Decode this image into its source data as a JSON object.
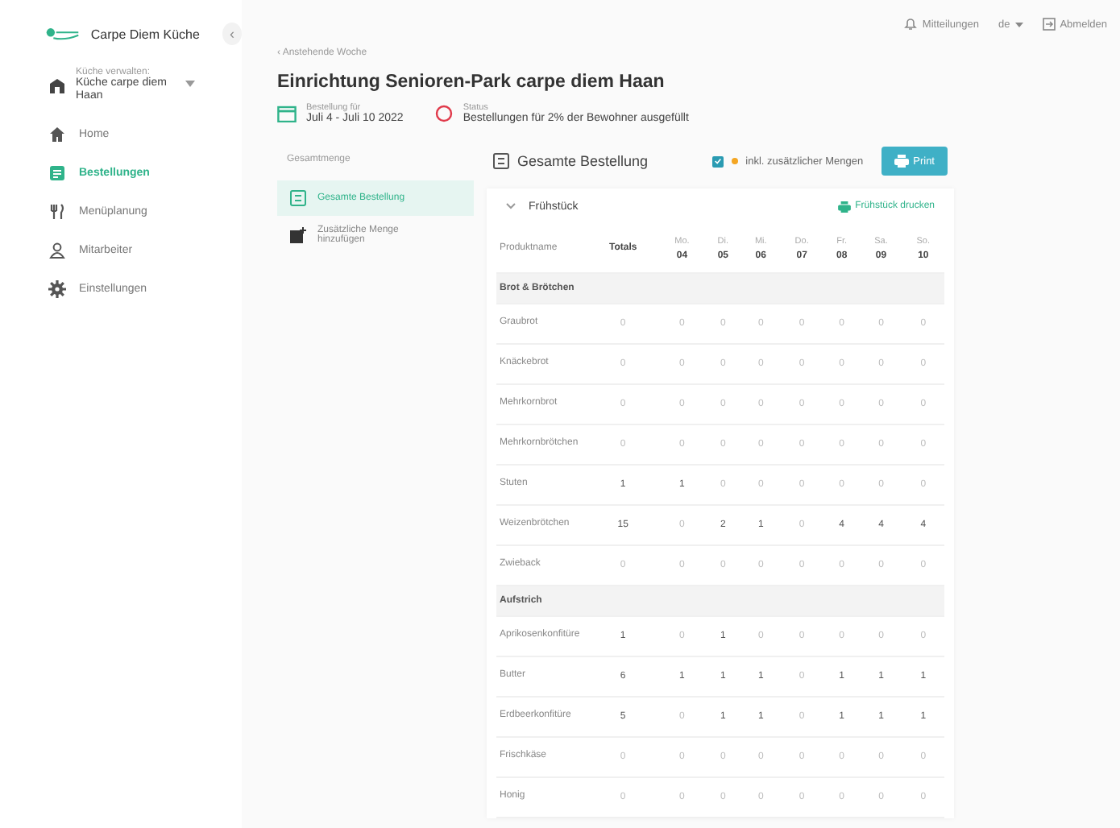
{
  "sidebar": {
    "brand": "Carpe Diem Küche",
    "collapse": "‹",
    "kitchen_label": "Küche verwalten:",
    "kitchen_value": "Küche carpe diem Haan",
    "items": [
      {
        "label": "Home",
        "selected": false
      },
      {
        "label": "Bestellungen",
        "selected": true
      },
      {
        "label": "Menüplanung",
        "selected": false
      },
      {
        "label": "Mitarbeiter",
        "selected": false
      },
      {
        "label": "Einstellungen",
        "selected": false
      }
    ]
  },
  "topbar": {
    "notifications": "Mitteilungen",
    "language": "de",
    "logout": "Abmelden"
  },
  "back_link": "‹ Anstehende Woche",
  "title": "Einrichtung Senioren-Park carpe diem Haan",
  "order_for": {
    "label": "Bestellung für",
    "value": "Juli 4 - Juli 10 2022"
  },
  "status": {
    "label": "Status",
    "value": "Bestellungen für 2% der Bewohner ausgefüllt"
  },
  "subnav": {
    "heading": "Gesamtmenge",
    "items": [
      {
        "label": "Gesamte Bestellung",
        "selected": true
      },
      {
        "label": "Zusätzliche Menge hinzufügen",
        "selected": false
      }
    ]
  },
  "panel": {
    "title": "Gesamte Bestellung",
    "include_extra": {
      "label": "inkl. zusätzlicher Mengen",
      "checked": true
    },
    "print": "Print"
  },
  "section": {
    "title": "Frühstück",
    "expanded": true,
    "print_link": "Frühstück drucken",
    "columns": {
      "product": "Produktname",
      "total": "Totals",
      "days": [
        {
          "day": "Mo.",
          "date": "04"
        },
        {
          "day": "Di.",
          "date": "05"
        },
        {
          "day": "Mi.",
          "date": "06"
        },
        {
          "day": "Do.",
          "date": "07"
        },
        {
          "day": "Fr.",
          "date": "08"
        },
        {
          "day": "Sa.",
          "date": "09"
        },
        {
          "day": "So.",
          "date": "10"
        }
      ]
    },
    "groups": [
      {
        "name": "Brot & Brötchen",
        "rows": [
          {
            "name": "Graubrot",
            "total": "0",
            "days": [
              "0",
              "0",
              "0",
              "0",
              "0",
              "0",
              "0"
            ]
          },
          {
            "name": "Knäckebrot",
            "total": "0",
            "days": [
              "0",
              "0",
              "0",
              "0",
              "0",
              "0",
              "0"
            ]
          },
          {
            "name": "Mehrkornbrot",
            "total": "0",
            "days": [
              "0",
              "0",
              "0",
              "0",
              "0",
              "0",
              "0"
            ]
          },
          {
            "name": "Mehrkornbrötchen",
            "total": "0",
            "days": [
              "0",
              "0",
              "0",
              "0",
              "0",
              "0",
              "0"
            ]
          },
          {
            "name": "Stuten",
            "total": "1",
            "days": [
              "1",
              "0",
              "0",
              "0",
              "0",
              "0",
              "0"
            ]
          },
          {
            "name": "Weizenbrötchen",
            "total": "15",
            "days": [
              "0",
              "2",
              "1",
              "0",
              "4",
              "4",
              "4"
            ]
          },
          {
            "name": "Zwieback",
            "total": "0",
            "days": [
              "0",
              "0",
              "0",
              "0",
              "0",
              "0",
              "0"
            ]
          }
        ]
      },
      {
        "name": "Aufstrich",
        "rows": [
          {
            "name": "Aprikosenkonfitüre",
            "total": "1",
            "days": [
              "0",
              "1",
              "0",
              "0",
              "0",
              "0",
              "0"
            ]
          },
          {
            "name": "Butter",
            "total": "6",
            "days": [
              "1",
              "1",
              "1",
              "0",
              "1",
              "1",
              "1"
            ]
          },
          {
            "name": "Erdbeerkonfitüre",
            "total": "5",
            "days": [
              "0",
              "1",
              "1",
              "0",
              "1",
              "1",
              "1"
            ]
          },
          {
            "name": "Frischkäse",
            "total": "0",
            "days": [
              "0",
              "0",
              "0",
              "0",
              "0",
              "0",
              "0"
            ]
          },
          {
            "name": "Honig",
            "total": "0",
            "days": [
              "0",
              "0",
              "0",
              "0",
              "0",
              "0",
              "0"
            ]
          }
        ]
      }
    ]
  }
}
